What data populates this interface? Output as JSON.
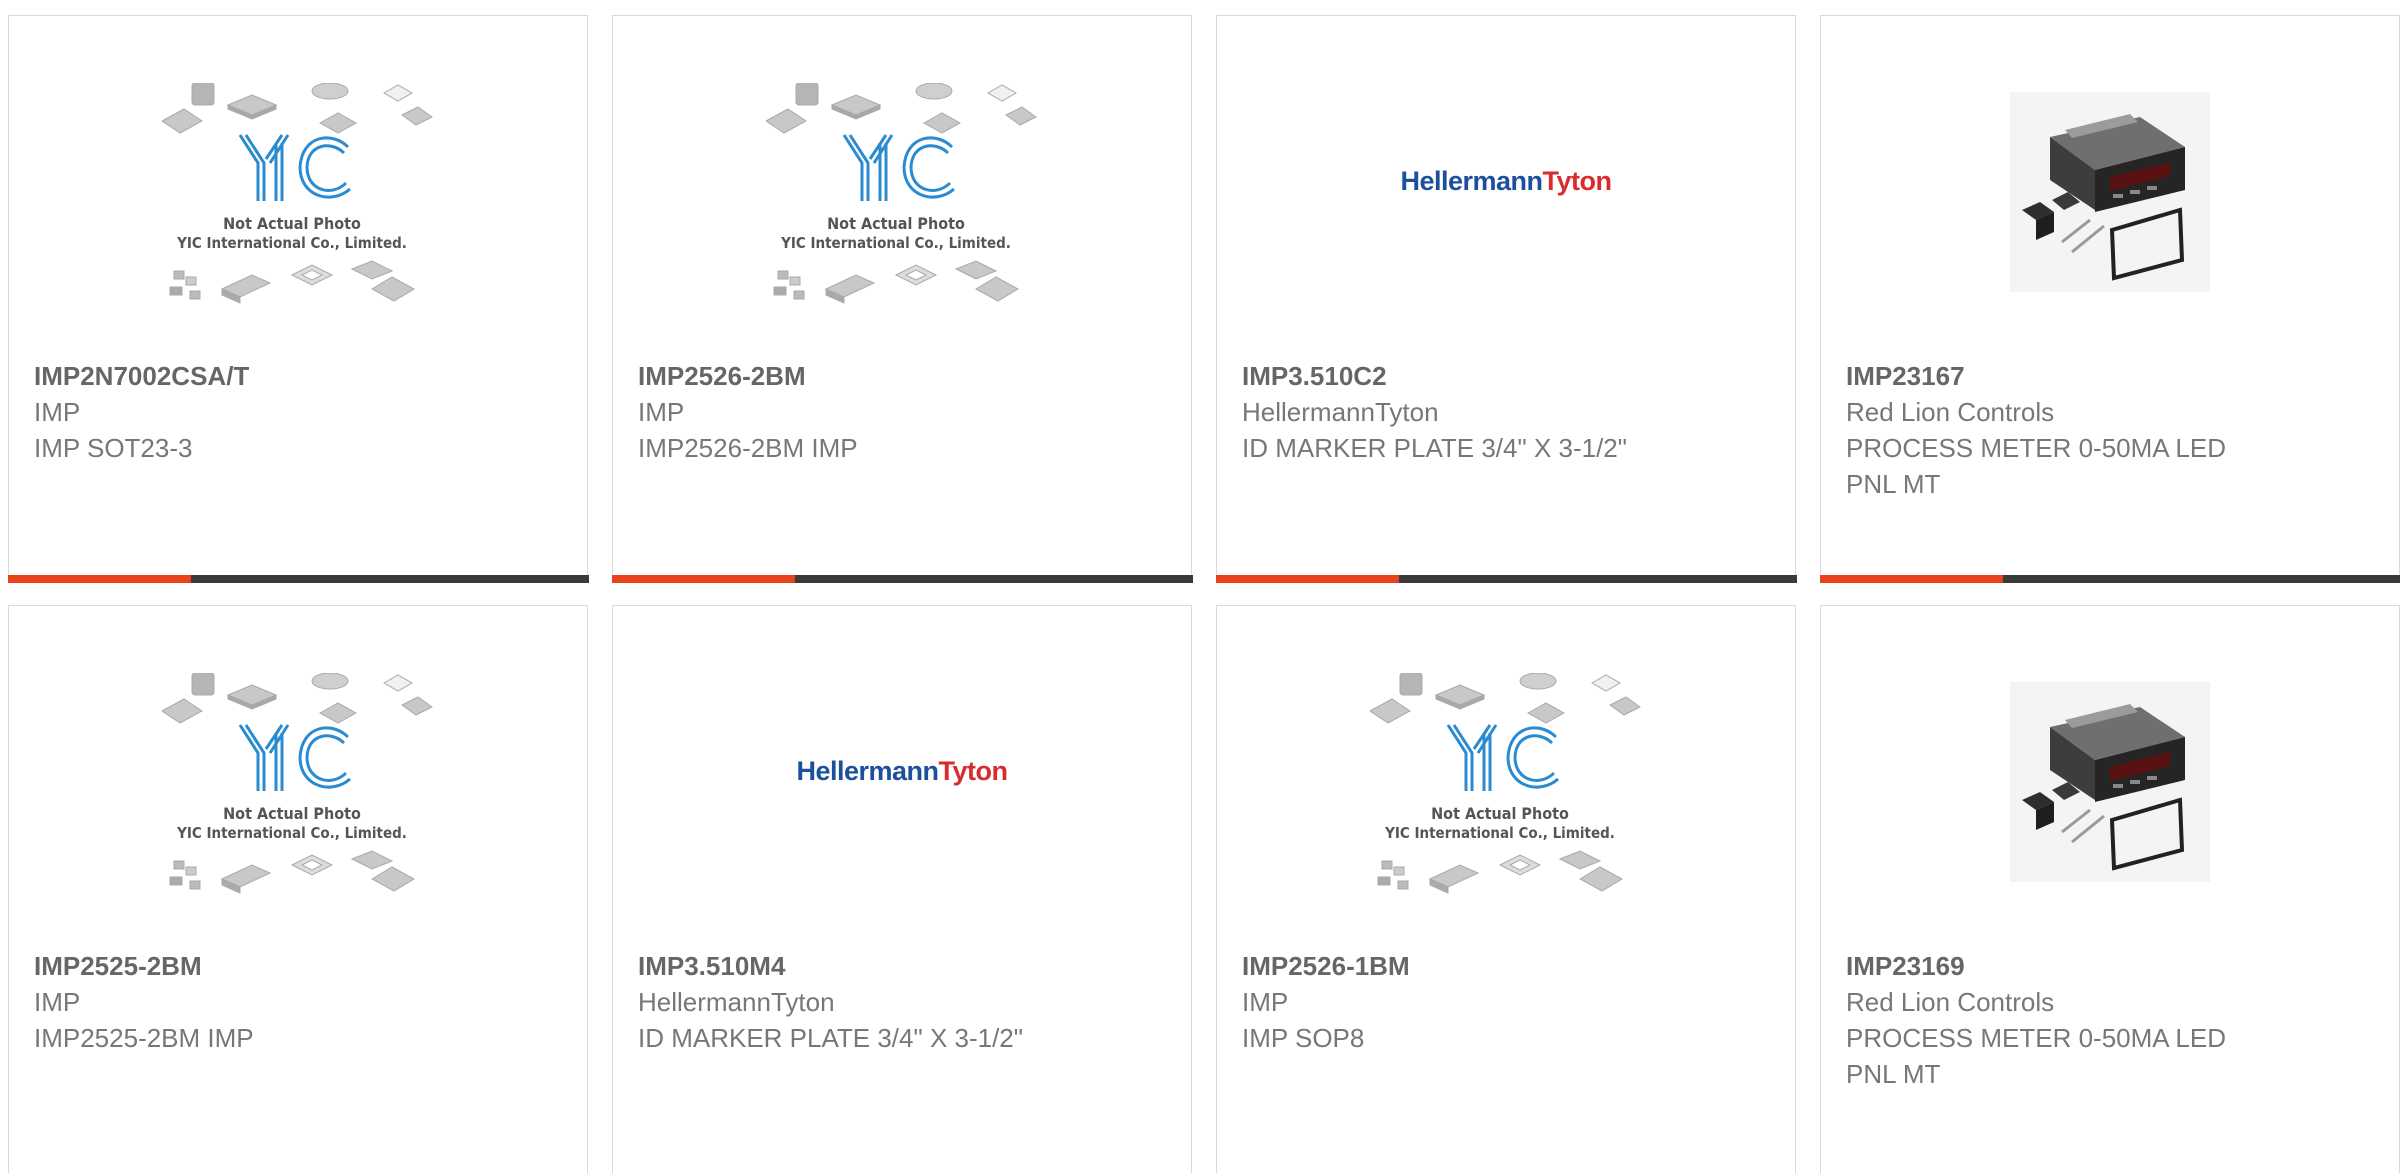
{
  "colors": {
    "accent": "#e8421b",
    "bar": "#3a3a3a",
    "yic_blue": "#2a8bd0",
    "hellermann_blue": "#1c4f9c",
    "hellermann_red": "#d92b2b"
  },
  "placeholder": {
    "line1": "Not Actual Photo",
    "line2": "YIC International Co., Limited."
  },
  "cards": [
    {
      "pn": "IMP2N7002CSA/T",
      "brand": "IMP",
      "desc": [
        "IMP SOT23-3"
      ],
      "image": "yic-placeholder-image"
    },
    {
      "pn": "IMP2526-2BM",
      "brand": "IMP",
      "desc": [
        "IMP2526-2BM IMP"
      ],
      "image": "yic-placeholder-image"
    },
    {
      "pn": "IMP3.510C2",
      "brand": "HellermannTyton",
      "desc": [
        "ID MARKER PLATE 3/4\" X 3-1/2\""
      ],
      "image": "hellermanntyton-logo"
    },
    {
      "pn": "IMP23167",
      "brand": "Red Lion Controls",
      "desc": [
        "PROCESS METER 0-50MA LED",
        "PNL MT"
      ],
      "image": "process-meter-photo"
    },
    {
      "pn": "IMP2525-2BM",
      "brand": "IMP",
      "desc": [
        "IMP2525-2BM IMP"
      ],
      "image": "yic-placeholder-image"
    },
    {
      "pn": "IMP3.510M4",
      "brand": "HellermannTyton",
      "desc": [
        "ID MARKER PLATE 3/4\" X 3-1/2\""
      ],
      "image": "hellermanntyton-logo"
    },
    {
      "pn": "IMP2526-1BM",
      "brand": "IMP",
      "desc": [
        "IMP SOP8"
      ],
      "image": "yic-placeholder-image"
    },
    {
      "pn": "IMP23169",
      "brand": "Red Lion Controls",
      "desc": [
        "PROCESS METER 0-50MA LED",
        "PNL MT"
      ],
      "image": "process-meter-photo"
    }
  ],
  "logo_text": {
    "hellermann": "Hellermann",
    "tyton": "Tyton"
  }
}
